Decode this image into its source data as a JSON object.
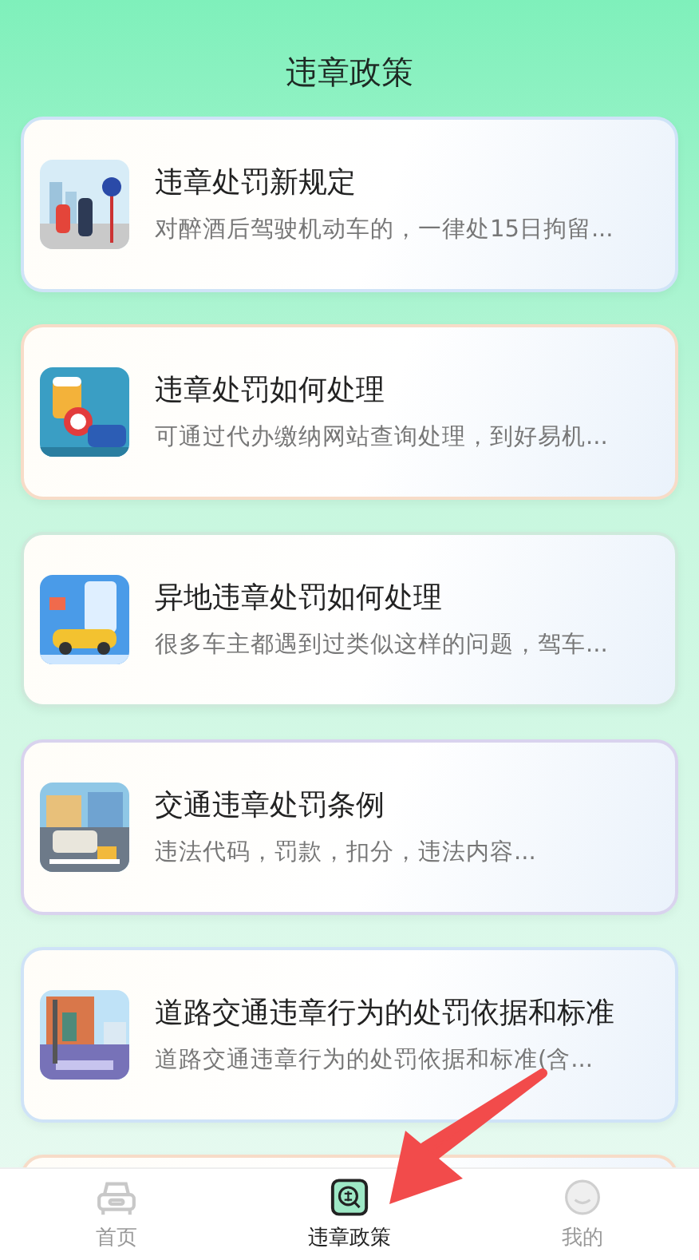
{
  "header": {
    "title": "违章政策"
  },
  "articles": [
    {
      "title": "违章处罚新规定",
      "summary": "对醉酒后驾驶机动车的，一律处15日拘留...",
      "color": "#cfe3f7",
      "kind": "picture"
    },
    {
      "title": "违章处罚如何处理",
      "summary": "可通过代办缴纳网站查询处理，到好易机...",
      "color": "#f7dcc8",
      "kind": "picture"
    },
    {
      "title": "异地违章处罚如何处理",
      "summary": "很多车主都遇到过类似这样的问题，驾车...",
      "color": "#cdeadb",
      "kind": "picture"
    },
    {
      "title": "交通违章处罚条例",
      "summary": "违法代码，罚款，扣分，违法内容...",
      "color": "#d9d3ee",
      "kind": "picture"
    },
    {
      "title": "道路交通违章行为的处罚依据和标准",
      "summary": "道路交通违章行为的处罚依据和标准(含...",
      "color": "#cfe3f7",
      "kind": "picture"
    },
    {
      "color": "#f7dcc8"
    }
  ],
  "tabs": [
    {
      "label": "首页",
      "kind": "car",
      "selected": false
    },
    {
      "label": "违章政策",
      "kind": "badge",
      "selected": true
    },
    {
      "label": "我的",
      "kind": "face",
      "selected": false
    }
  ]
}
